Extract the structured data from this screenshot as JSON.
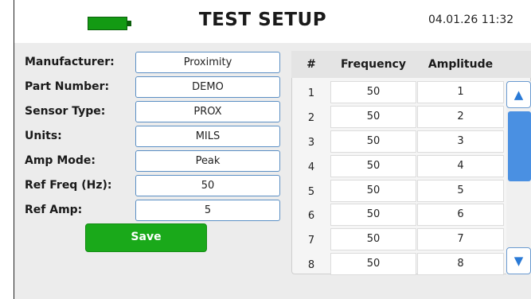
{
  "header": {
    "title": "TEST SETUP",
    "datetime": "04.01.26 11:32",
    "battery_icon": "battery-full-icon",
    "battery_color": "#139a13"
  },
  "form": {
    "fields": [
      {
        "label": "Manufacturer:",
        "value": "Proximity"
      },
      {
        "label": "Part Number:",
        "value": "DEMO"
      },
      {
        "label": "Sensor Type:",
        "value": "PROX"
      },
      {
        "label": "Units:",
        "value": "MILS"
      },
      {
        "label": "Amp Mode:",
        "value": "Peak"
      },
      {
        "label": "Ref Freq (Hz):",
        "value": "50"
      },
      {
        "label": "Ref Amp:",
        "value": "5"
      }
    ],
    "save_label": "Save",
    "save_color": "#1aa91a"
  },
  "table": {
    "columns": [
      "#",
      "Frequency",
      "Amplitude"
    ],
    "rows": [
      {
        "num": "1",
        "frequency": "50",
        "amplitude": "1"
      },
      {
        "num": "2",
        "frequency": "50",
        "amplitude": "2"
      },
      {
        "num": "3",
        "frequency": "50",
        "amplitude": "3"
      },
      {
        "num": "4",
        "frequency": "50",
        "amplitude": "4"
      },
      {
        "num": "5",
        "frequency": "50",
        "amplitude": "5"
      },
      {
        "num": "6",
        "frequency": "50",
        "amplitude": "6"
      },
      {
        "num": "7",
        "frequency": "50",
        "amplitude": "7"
      },
      {
        "num": "8",
        "frequency": "50",
        "amplitude": "8"
      }
    ]
  },
  "scroll": {
    "up_icon": "chevron-up-icon",
    "down_icon": "chevron-down-icon",
    "up_glyph": "▲",
    "down_glyph": "▼",
    "accent_color": "#4a90e2"
  }
}
